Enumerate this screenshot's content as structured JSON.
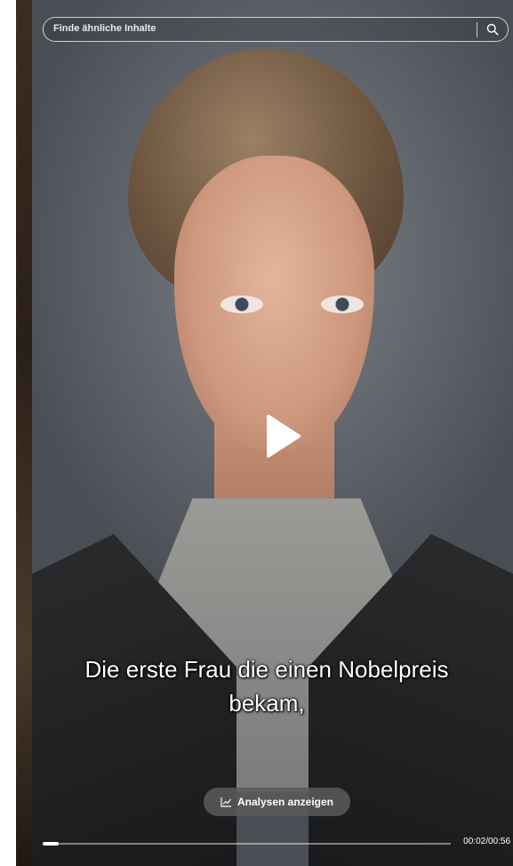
{
  "search": {
    "placeholder": "Finde ähnliche Inhalte",
    "icon": "search-icon"
  },
  "player": {
    "play_icon": "play-icon",
    "subtitle_line1": "Die erste Frau die einen Nobelpreis",
    "subtitle_line2": "bekam,",
    "analytics_label": "Analysen anzeigen",
    "analytics_icon": "line-chart-icon",
    "time_current": "00:02",
    "time_total": "00:56",
    "time_display": "00:02/00:56",
    "progress_fraction": 0.036
  },
  "colors": {
    "accent": "#ffffff",
    "button_bg": "#5a5a5c"
  }
}
